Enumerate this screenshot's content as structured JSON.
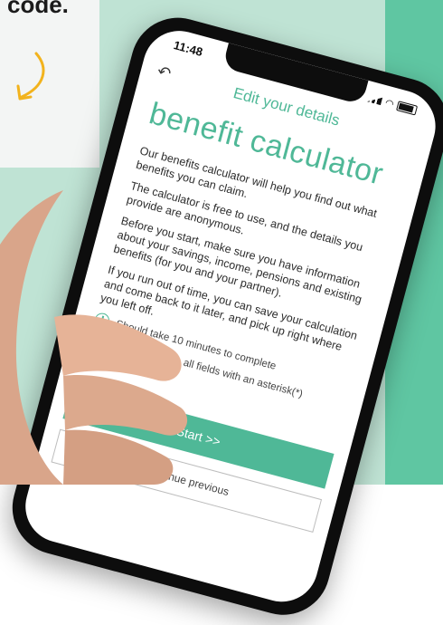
{
  "background": {
    "code_text": "code.",
    "panel_color": "#bfe3d4",
    "strip_color": "#5fc6a2",
    "arrow_color": "#f2b31d"
  },
  "status_bar": {
    "time": "11:48",
    "icons": [
      "signal-icon",
      "wifi-icon",
      "battery-icon"
    ]
  },
  "header": {
    "back_icon": "back-arrow-icon",
    "title": "Edit your details"
  },
  "main": {
    "heading": "benefit calculator",
    "paragraphs": [
      "Our benefits calculator will help you find out what benefits you can claim.",
      "The calculator is free to use, and the details you provide are anonymous.",
      "Before you start, make sure you have information about your savings, income, pensions and existing benefits (for you and your partner).",
      "If you run out of time, you can save your calculation and come back to it later, and pick up right where you left off."
    ],
    "notes": [
      {
        "icon": "clock-icon",
        "text": "Should take 10 minutes to complete"
      },
      {
        "icon": "pencil-icon",
        "text": "Please complete all fields with an asterisk(*)"
      }
    ],
    "start_button": "Start >>",
    "continue_button": "Continue previous"
  },
  "accent_color": "#4fb897"
}
